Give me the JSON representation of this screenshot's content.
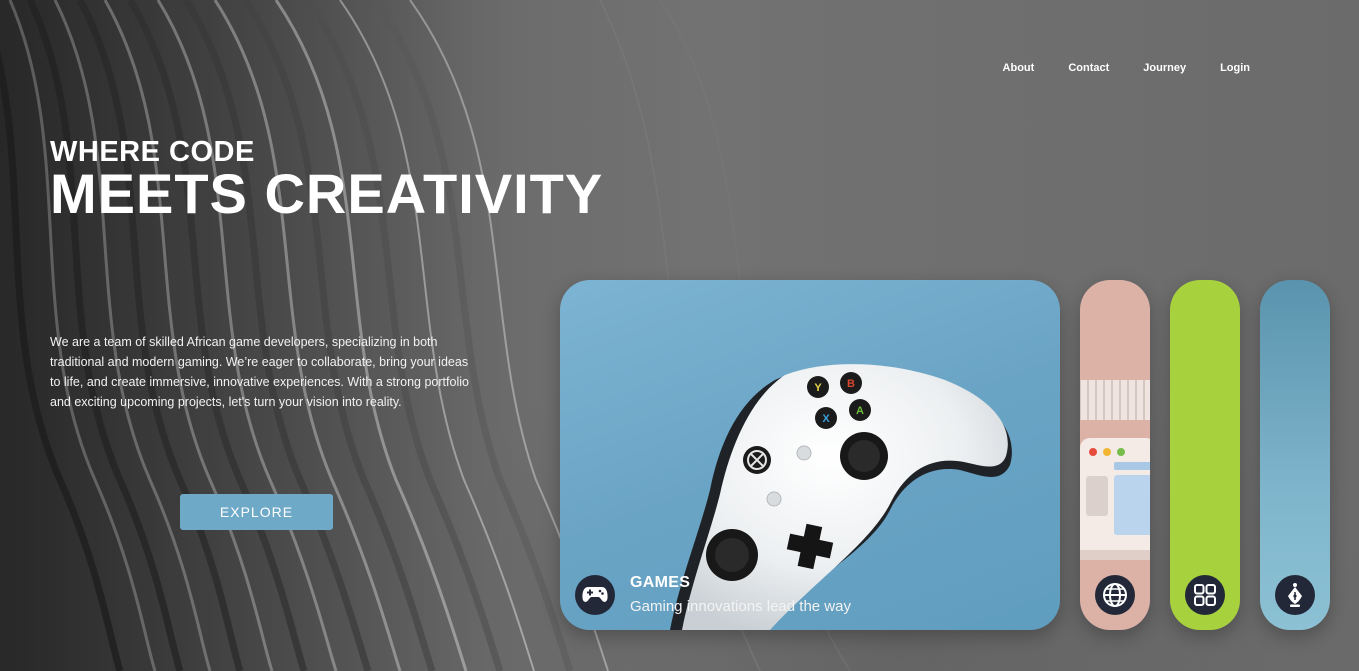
{
  "nav": {
    "items": [
      "About",
      "Contact",
      "Journey",
      "Login"
    ]
  },
  "hero": {
    "subtitle": "WHERE CODE",
    "title": "MEETS CREATIVITY",
    "description": "We are a team of skilled African game developers, specializing in both traditional and modern gaming. We’re eager to collaborate, bring your ideas to life, and create immersive, innovative experiences. With a strong portfolio and exciting upcoming projects, let's turn your vision into reality.",
    "cta_label": "EXPLORE"
  },
  "cards": {
    "active": {
      "title": "GAMES",
      "caption": "Gaming innovations lead the way",
      "icon": "gamepad-icon",
      "color": "#6ea9c8"
    },
    "collapsed": [
      {
        "icon": "globe-icon",
        "color": "#dcb2a7"
      },
      {
        "icon": "grid-icon",
        "color": "#a8d13e"
      },
      {
        "icon": "pen-nib-icon",
        "color": "#7fb5cc"
      }
    ]
  },
  "colors": {
    "accent": "#6ea9c8",
    "icon_bg": "#222838"
  }
}
